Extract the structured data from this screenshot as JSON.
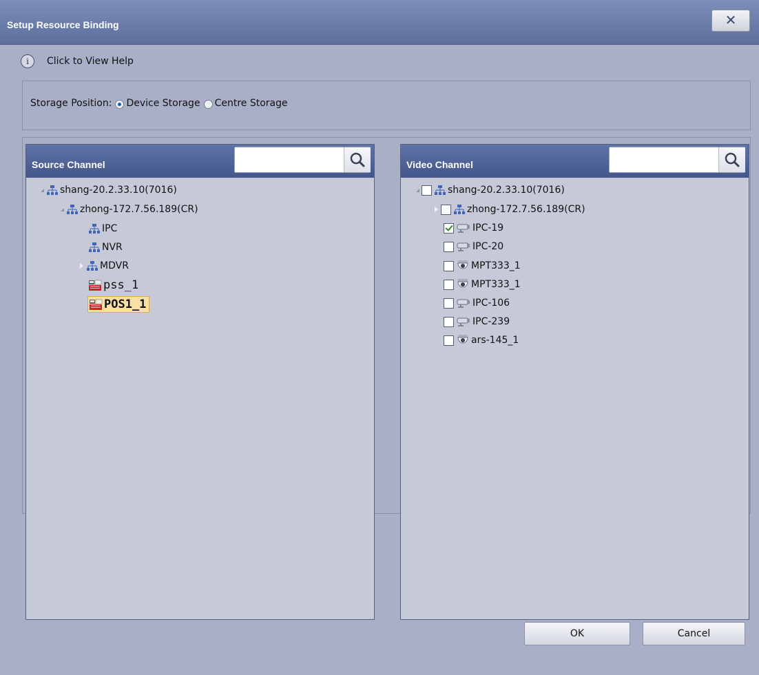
{
  "window": {
    "title": "Setup Resource Binding",
    "close_symbol": "✕"
  },
  "help": {
    "info_symbol": "i",
    "label": "Click to View Help"
  },
  "storage": {
    "label": "Storage Position:",
    "options": [
      "Device Storage",
      "Centre Storage"
    ],
    "selected": "Device Storage"
  },
  "source_panel": {
    "title": "Source Channel",
    "search_placeholder": "",
    "tree": [
      {
        "label": "shang-20.2.33.10(7016)",
        "icon": "network-icon",
        "expanded": true
      },
      {
        "label": "zhong-172.7.56.189(CR)",
        "icon": "network-icon",
        "expanded": true
      },
      {
        "label": "IPC",
        "icon": "network-icon"
      },
      {
        "label": "NVR",
        "icon": "network-icon"
      },
      {
        "label": "MDVR",
        "icon": "network-icon",
        "expanded": false
      },
      {
        "label": "pss_1",
        "icon": "pos-terminal-icon"
      },
      {
        "label": "POS1_1",
        "icon": "pos-terminal-icon",
        "selected": true
      }
    ]
  },
  "video_panel": {
    "title": "Video Channel",
    "search_placeholder": "",
    "tree": [
      {
        "label": "shang-20.2.33.10(7016)",
        "icon": "network-icon",
        "checked": false,
        "expanded": true
      },
      {
        "label": "zhong-172.7.56.189(CR)",
        "icon": "network-icon",
        "checked": false,
        "expanded": false
      },
      {
        "label": "IPC-19",
        "icon": "bullet-camera-icon",
        "checked": true
      },
      {
        "label": "IPC-20",
        "icon": "bullet-camera-icon",
        "checked": false
      },
      {
        "label": "MPT333_1",
        "icon": "dome-camera-icon",
        "checked": false
      },
      {
        "label": "MPT333_1",
        "icon": "dome-camera-icon",
        "checked": false
      },
      {
        "label": "IPC-106",
        "icon": "bullet-camera-icon",
        "checked": false
      },
      {
        "label": "IPC-239",
        "icon": "bullet-camera-icon",
        "checked": false
      },
      {
        "label": "ars-145_1",
        "icon": "dome-camera-icon",
        "checked": false
      }
    ]
  },
  "footer": {
    "ok_label": "OK",
    "cancel_label": "Cancel"
  }
}
